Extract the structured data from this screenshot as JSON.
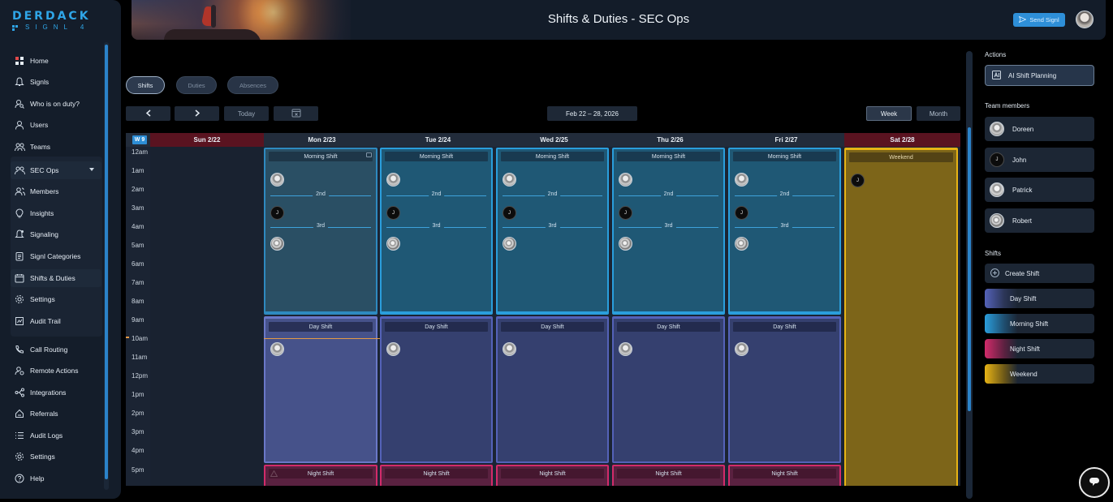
{
  "brand": {
    "name": "DERDACK",
    "product": "SIGNL 4"
  },
  "sidebar": {
    "items": [
      {
        "label": "Home",
        "icon": "home-icon"
      },
      {
        "label": "Signls",
        "icon": "bell-icon"
      },
      {
        "label": "Who is on duty?",
        "icon": "user-search-icon"
      },
      {
        "label": "Users",
        "icon": "user-icon"
      },
      {
        "label": "Teams",
        "icon": "team-icon"
      }
    ],
    "team": {
      "label": "SEC Ops",
      "icon": "team-icon"
    },
    "team_items": [
      {
        "label": "Members",
        "icon": "members-icon"
      },
      {
        "label": "Insights",
        "icon": "insights-icon"
      },
      {
        "label": "Signaling",
        "icon": "signaling-icon"
      },
      {
        "label": "Signl Categories",
        "icon": "categories-icon"
      },
      {
        "label": "Shifts & Duties",
        "icon": "calendar-icon"
      },
      {
        "label": "Settings",
        "icon": "gear-icon"
      },
      {
        "label": "Audit Trail",
        "icon": "audit-icon"
      }
    ],
    "bottom_items": [
      {
        "label": "Call Routing",
        "icon": "phone-icon"
      },
      {
        "label": "Remote Actions",
        "icon": "remote-icon"
      },
      {
        "label": "Integrations",
        "icon": "integrations-icon"
      },
      {
        "label": "Referrals",
        "icon": "referrals-icon"
      },
      {
        "label": "Audit Logs",
        "icon": "list-icon"
      },
      {
        "label": "Settings",
        "icon": "gear-icon"
      },
      {
        "label": "Help",
        "icon": "help-icon"
      }
    ]
  },
  "header": {
    "title": "Shifts & Duties - SEC Ops",
    "send_label": "Send Signl"
  },
  "tabs": {
    "shifts": "Shifts",
    "duties": "Duties",
    "absences": "Absences"
  },
  "toolbar": {
    "today": "Today",
    "date_range": "Feb 22 – 28, 2026",
    "week": "Week",
    "month": "Month"
  },
  "calendar": {
    "week_label": "W 9",
    "days": [
      "Sun 2/22",
      "Mon 2/23",
      "Tue 2/24",
      "Wed 2/25",
      "Thu 2/26",
      "Fri 2/27",
      "Sat 2/28"
    ],
    "times": [
      "12am",
      "1am",
      "2am",
      "3am",
      "4am",
      "5am",
      "6am",
      "7am",
      "8am",
      "9am",
      "10am",
      "11am",
      "12pm",
      "1pm",
      "2pm",
      "3pm",
      "4pm",
      "5pm"
    ],
    "shift_names": {
      "morning": "Morning Shift",
      "day": "Day Shift",
      "night": "Night Shift",
      "weekend": "Weekend"
    },
    "sub_labels": {
      "second": "2nd",
      "third": "3rd"
    },
    "member_initial": "J"
  },
  "right_panel": {
    "actions_title": "Actions",
    "ai_label": "AI Shift Planning",
    "team_title": "Team members",
    "members": [
      "Doreen",
      "John",
      "Patrick",
      "Robert"
    ],
    "shifts_title": "Shifts",
    "create_label": "Create Shift",
    "shifts": [
      {
        "label": "Day Shift",
        "color": "#5462b8"
      },
      {
        "label": "Morning Shift",
        "color": "#2a9edc"
      },
      {
        "label": "Night Shift",
        "color": "#d22b6a"
      },
      {
        "label": "Weekend",
        "color": "#e7b315"
      }
    ]
  }
}
